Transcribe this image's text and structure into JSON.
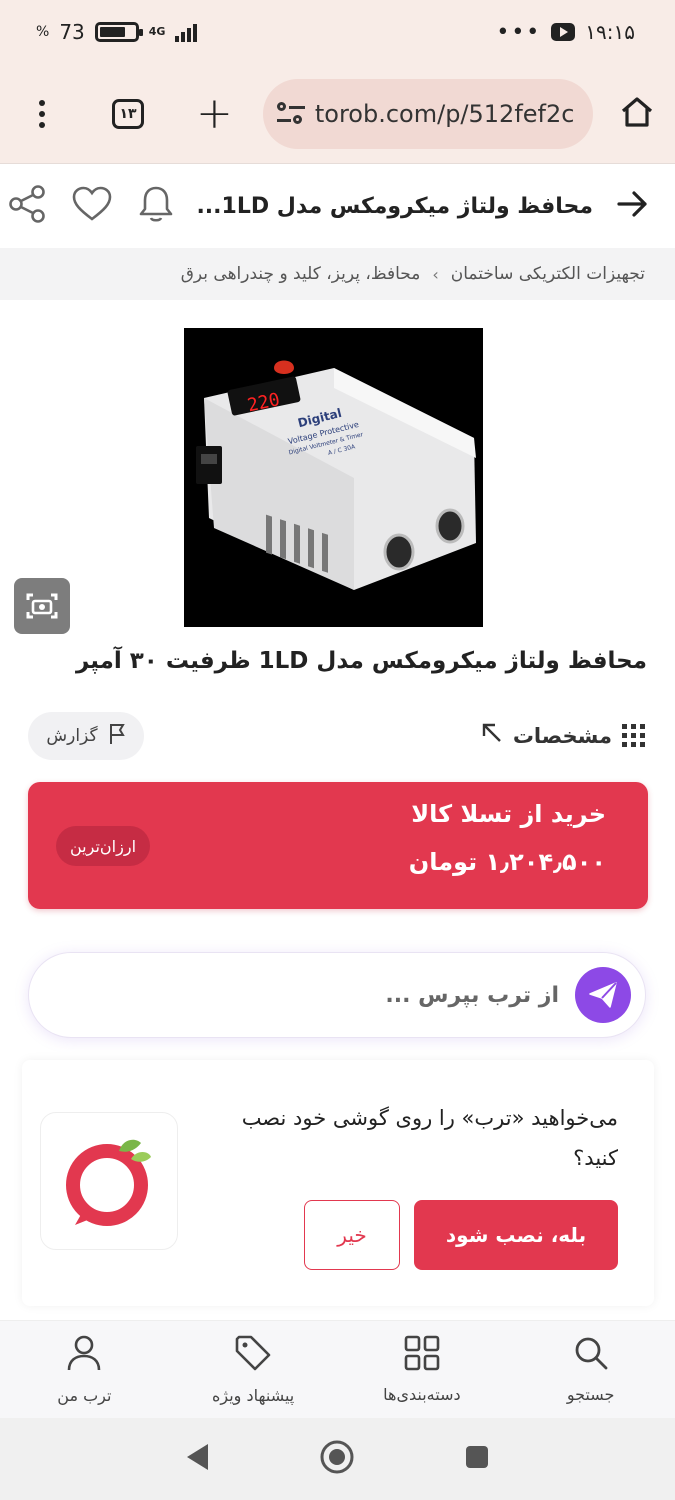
{
  "status_bar": {
    "time": "۱۹:۱۵",
    "battery_percent": "73",
    "battery_symbol": "%",
    "network": "4G",
    "battery_level": 0.73
  },
  "browser": {
    "url": "torob.com/p/512fef2c",
    "tab_count": "۱۳"
  },
  "header": {
    "title": "محافظ ولتاژ میکرومکس مدل 1LD..."
  },
  "breadcrumb": {
    "items": [
      "تجهیزات الکتریکی ساختمان",
      "محافظ، پریز، کلید و چندراهی برق"
    ],
    "separator": "›"
  },
  "product": {
    "title": "محافظ ولتاژ میکرومکس مدل 1LD ظرفیت ۳۰ آمپر",
    "image_text": {
      "display": "220",
      "line1": "Digital",
      "line2": "Voltage Protective",
      "line3": "Digital Voltmeter & Timer",
      "line4": "A / C 30A"
    }
  },
  "actions": {
    "specs_label": "مشخصات",
    "report_label": "گزارش"
  },
  "offer": {
    "store": "خرید از تسلا کالا",
    "price": "۱٫۲۰۴٫۵۰۰ تومان",
    "badge": "ارزان‌ترین"
  },
  "ask": {
    "placeholder": "از ترب بپرس ..."
  },
  "install_prompt": {
    "question": "می‌خواهید «ترب» را روی گوشی خود نصب کنید؟",
    "yes_label": "بله، نصب شود",
    "no_label": "خیر"
  },
  "bottom_nav": [
    {
      "label": "جستجو",
      "icon": "search-icon"
    },
    {
      "label": "دسته‌بندی‌ها",
      "icon": "grid-icon"
    },
    {
      "label": "پیشنهاد ویژه",
      "icon": "tag-icon"
    },
    {
      "label": "ترب من",
      "icon": "user-icon"
    }
  ],
  "colors": {
    "accent": "#e2384f",
    "purple": "#8d49e6",
    "browser_bg": "#f8ece7"
  }
}
